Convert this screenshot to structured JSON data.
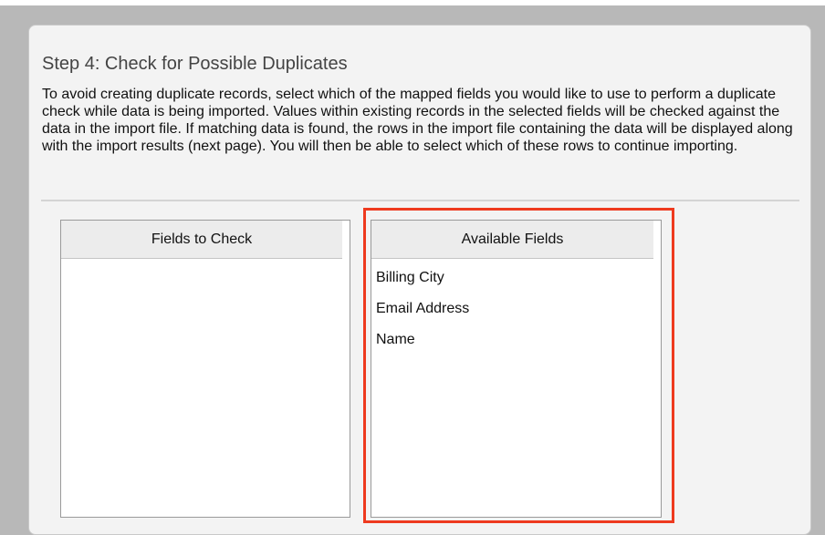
{
  "step": {
    "title": "Step 4: Check for Possible Duplicates",
    "instructions": "To avoid creating duplicate records, select which of the mapped fields you would like to use to perform a duplicate check while data is being imported. Values within existing records in the selected fields will be checked against the data in the import file. If matching data is found, the rows in the import file containing the data will be displayed along with the import results (next page). You will then be able to select which of these rows to continue importing."
  },
  "fields_to_check": {
    "header": "Fields to Check",
    "items": []
  },
  "available_fields": {
    "header": "Available Fields",
    "items": [
      {
        "label": "Billing City"
      },
      {
        "label": "Email Address"
      },
      {
        "label": "Name"
      }
    ]
  },
  "colors": {
    "highlight": "#ee3a1f",
    "dialog_bg": "#f3f3f3",
    "backdrop": "#b8b8b8"
  }
}
